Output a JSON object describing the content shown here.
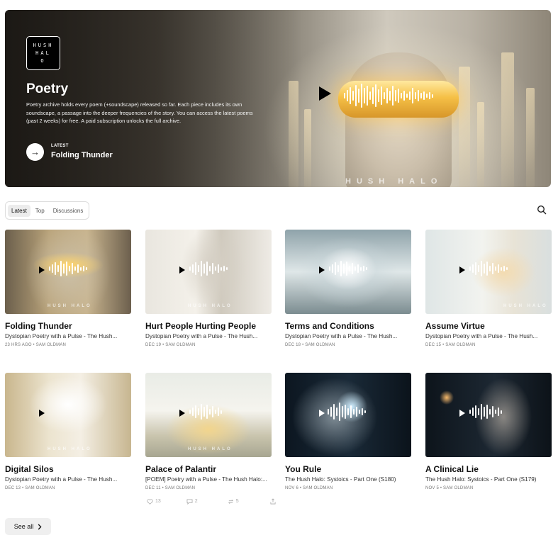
{
  "hero": {
    "logo_text": "HUSH\nHAL\nO",
    "title": "Poetry",
    "description": "Poetry archive holds every poem (+soundscape) released so far. Each piece includes its own soundscape, a passage into the deeper frequencies of the story. You can access the latest poems (past 2 weeks) for free. A paid subscription unlocks the full archive.",
    "latest_label": "LATEST",
    "latest_title": "Folding Thunder",
    "brand_watermark": "HUSH HALO"
  },
  "tabs": [
    {
      "label": "Latest",
      "active": true
    },
    {
      "label": "Top",
      "active": false
    },
    {
      "label": "Discussions",
      "active": false
    }
  ],
  "posts": [
    {
      "title": "Folding Thunder",
      "subtitle": "Dystopian Poetry with a Pulse - The Hush...",
      "meta": "23 HRS AGO • SAM OLDMAN",
      "palette": "gold-visor",
      "watermark": "HUSH HALO"
    },
    {
      "title": "Hurt People Hurting People",
      "subtitle": "Dystopian Poetry with a Pulse - The Hush...",
      "meta": "DEC 19 • SAM OLDMAN",
      "palette": "pale-face",
      "watermark": "HUSH HALO"
    },
    {
      "title": "Terms and Conditions",
      "subtitle": "Dystopian Poetry with a Pulse - The Hush...",
      "meta": "DEC 18 • SAM OLDMAN",
      "palette": "tv-glow",
      "watermark": ""
    },
    {
      "title": "Assume Virtue",
      "subtitle": "Dystopian Poetry with a Pulse - The Hush...",
      "meta": "DEC 15 • SAM OLDMAN",
      "palette": "rose",
      "watermark": "HUSH HALO"
    },
    {
      "title": "Digital Silos",
      "subtitle": "Dystopian Poetry with a Pulse - The Hush...",
      "meta": "DEC 13 • SAM OLDMAN",
      "palette": "silo",
      "watermark": "HUSH HALO"
    },
    {
      "title": "Palace of Palantir",
      "subtitle": "[POEM] Poetry with a Pulse - The Hush Halo:...",
      "meta": "DEC 11 • SAM OLDMAN",
      "palette": "palace",
      "watermark": "HUSH HALO"
    },
    {
      "title": "You Rule",
      "subtitle": "The Hush Halo: Systoics - Part One (S180)",
      "meta": "NOV 6 • SAM OLDMAN",
      "palette": "dark-blue",
      "watermark": ""
    },
    {
      "title": "A Clinical Lie",
      "subtitle": "The Hush Halo: Systoics - Part One (S179)",
      "meta": "NOV 5 • SAM OLDMAN",
      "palette": "dark-old",
      "watermark": ""
    }
  ],
  "engagement": {
    "likes": "13",
    "comments": "2",
    "restacks": "5"
  },
  "see_all_label": "See all"
}
